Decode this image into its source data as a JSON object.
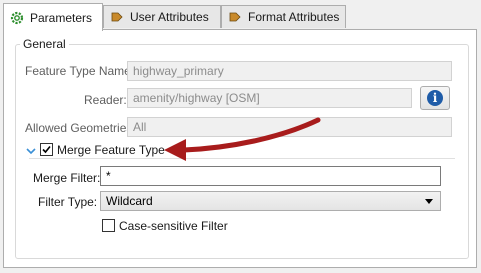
{
  "tabs": [
    {
      "label": "Parameters",
      "icon": "gear-icon"
    },
    {
      "label": "User Attributes",
      "icon": "attribute-arrow-icon"
    },
    {
      "label": "Format Attributes",
      "icon": "attribute-arrow-icon"
    }
  ],
  "general": {
    "title": "General",
    "feature_type_name": {
      "label": "Feature Type Name:",
      "value": "highway_primary"
    },
    "reader": {
      "label": "Reader:",
      "value": "amenity/highway [OSM]"
    },
    "allowed_geometries": {
      "label": "Allowed Geometries:",
      "value": "All"
    },
    "merge_feature_type": {
      "label": "Merge Feature Type",
      "checked": true
    },
    "merge_filter": {
      "label": "Merge Filter:",
      "value": "*"
    },
    "filter_type": {
      "label": "Filter Type:",
      "value": "Wildcard"
    },
    "case_sensitive": {
      "label": "Case-sensitive Filter",
      "checked": false
    }
  },
  "colors": {
    "arrow": "#a81c1c",
    "accent": "#1f5ca8"
  }
}
